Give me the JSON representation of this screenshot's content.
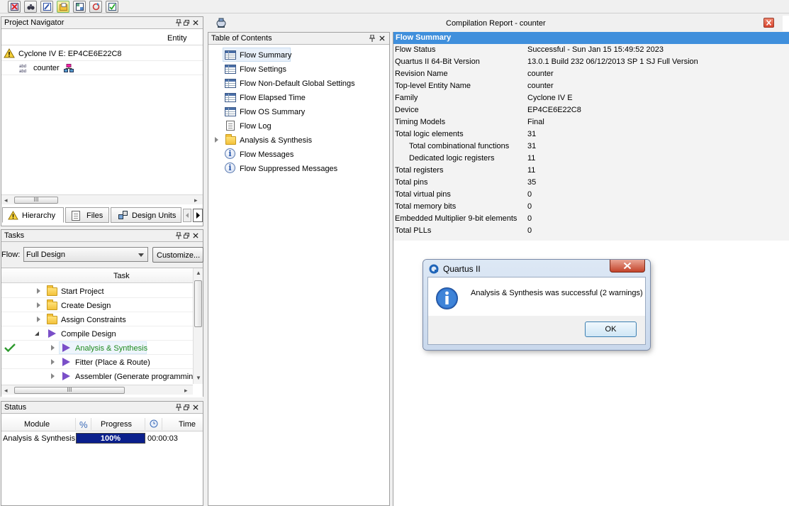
{
  "toolbar": {
    "icons": [
      "stop-icon",
      "binoculars-icon",
      "edit-icon",
      "open-folder-icon",
      "layout-icon",
      "refresh-icon",
      "checklist-icon"
    ]
  },
  "project_navigator": {
    "title": "Project Navigator",
    "column_header": "Entity",
    "device": "Cyclone IV E: EP4CE6E22C8",
    "entity": "counter",
    "scroll_thumb": "III",
    "tabs": [
      {
        "label": "Hierarchy"
      },
      {
        "label": "Files"
      },
      {
        "label": "Design Units"
      }
    ]
  },
  "tasks": {
    "title": "Tasks",
    "flow_label": "Flow:",
    "flow_value": "Full Design",
    "customize_label": "Customize...",
    "column_header": "Task",
    "scroll_thumb": "III",
    "items": [
      {
        "label": "Start Project"
      },
      {
        "label": "Create Design"
      },
      {
        "label": "Assign Constraints"
      },
      {
        "label": "Compile Design"
      },
      {
        "label": "Analysis & Synthesis"
      },
      {
        "label": "Fitter (Place & Route)"
      },
      {
        "label": "Assembler (Generate programming files)"
      }
    ]
  },
  "status": {
    "title": "Status",
    "headers": {
      "module": "Module",
      "percent": "%",
      "progress": "Progress",
      "time": "Time"
    },
    "row": {
      "module": "Analysis & Synthesis",
      "progress_label": "100%",
      "progress_fraction": 1.0,
      "time": "00:00:03"
    }
  },
  "report": {
    "title": "Compilation Report - counter",
    "toc_title": "Table of Contents",
    "toc_items": [
      {
        "label": "Flow Summary"
      },
      {
        "label": "Flow Settings"
      },
      {
        "label": "Flow Non-Default Global Settings"
      },
      {
        "label": "Flow Elapsed Time"
      },
      {
        "label": "Flow OS Summary"
      },
      {
        "label": "Flow Log"
      },
      {
        "label": "Analysis & Synthesis"
      },
      {
        "label": "Flow Messages"
      },
      {
        "label": "Flow Suppressed Messages"
      }
    ],
    "summary_title": "Flow Summary",
    "summary_rows": [
      {
        "key": "Flow Status",
        "value": "Successful - Sun Jan 15 15:49:52 2023"
      },
      {
        "key": "Quartus II 64-Bit Version",
        "value": "13.0.1 Build 232 06/12/2013 SP 1 SJ Full Version"
      },
      {
        "key": "Revision Name",
        "value": "counter"
      },
      {
        "key": "Top-level Entity Name",
        "value": "counter"
      },
      {
        "key": "Family",
        "value": "Cyclone IV E"
      },
      {
        "key": "Device",
        "value": "EP4CE6E22C8"
      },
      {
        "key": "Timing Models",
        "value": "Final"
      },
      {
        "key": "Total logic elements",
        "value": "31"
      },
      {
        "key": "Total combinational functions",
        "value": "31"
      },
      {
        "key": "Dedicated logic registers",
        "value": "11"
      },
      {
        "key": "Total registers",
        "value": "11"
      },
      {
        "key": "Total pins",
        "value": "35"
      },
      {
        "key": "Total virtual pins",
        "value": "0"
      },
      {
        "key": "Total memory bits",
        "value": "0"
      },
      {
        "key": "Embedded Multiplier 9-bit elements",
        "value": "0"
      },
      {
        "key": "Total PLLs",
        "value": "0"
      }
    ]
  },
  "dialog": {
    "title": "Quartus II",
    "message": "Analysis & Synthesis was successful (2 warnings)",
    "ok_label": "OK"
  },
  "colors": {
    "summary_header": "#3f8fdc",
    "progress_fill": "#0a1f8c",
    "active_task_text": "#1e8a1e",
    "close_red": "#d9432d"
  }
}
